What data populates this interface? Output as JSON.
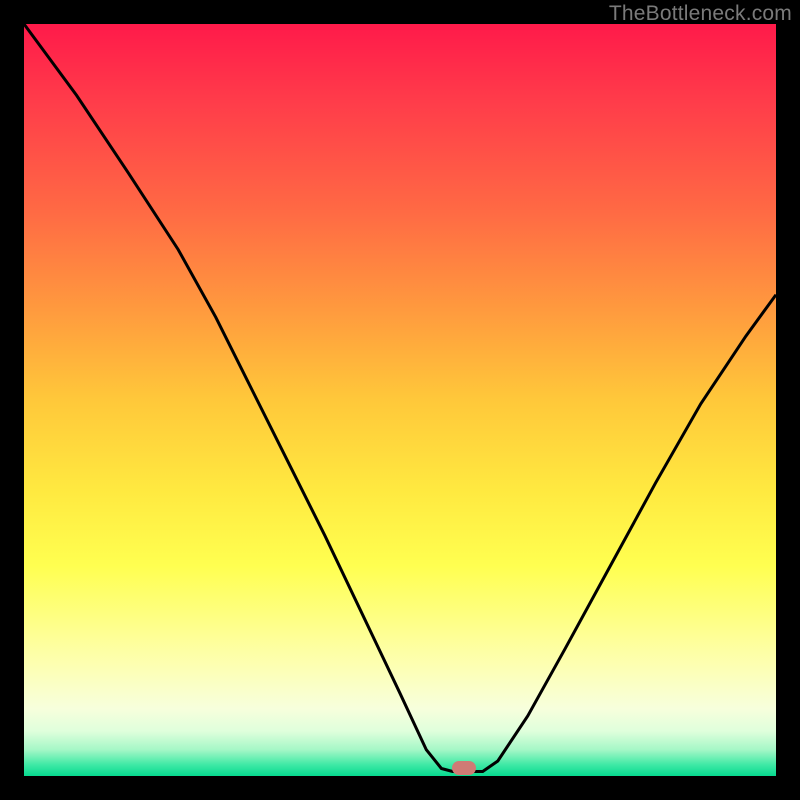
{
  "watermark": "TheBottleneck.com",
  "marker": {
    "x_frac": 0.585,
    "y_frac": 0.994
  },
  "chart_data": {
    "type": "line",
    "title": "",
    "xlabel": "",
    "ylabel": "",
    "xlim": [
      0,
      1
    ],
    "ylim": [
      0,
      1
    ],
    "series": [
      {
        "name": "bottleneck-curve",
        "points": [
          {
            "x": 0.0,
            "y": 1.0
          },
          {
            "x": 0.07,
            "y": 0.905
          },
          {
            "x": 0.14,
            "y": 0.8
          },
          {
            "x": 0.205,
            "y": 0.7
          },
          {
            "x": 0.255,
            "y": 0.61
          },
          {
            "x": 0.3,
            "y": 0.52
          },
          {
            "x": 0.35,
            "y": 0.42
          },
          {
            "x": 0.4,
            "y": 0.32
          },
          {
            "x": 0.45,
            "y": 0.215
          },
          {
            "x": 0.5,
            "y": 0.11
          },
          {
            "x": 0.535,
            "y": 0.035
          },
          {
            "x": 0.555,
            "y": 0.01
          },
          {
            "x": 0.57,
            "y": 0.006
          },
          {
            "x": 0.61,
            "y": 0.006
          },
          {
            "x": 0.63,
            "y": 0.02
          },
          {
            "x": 0.67,
            "y": 0.08
          },
          {
            "x": 0.72,
            "y": 0.17
          },
          {
            "x": 0.78,
            "y": 0.28
          },
          {
            "x": 0.84,
            "y": 0.39
          },
          {
            "x": 0.9,
            "y": 0.495
          },
          {
            "x": 0.96,
            "y": 0.585
          },
          {
            "x": 1.0,
            "y": 0.64
          }
        ]
      }
    ]
  },
  "colors": {
    "background": "#000000",
    "curve": "#000000",
    "marker": "#cf7b75",
    "watermark": "#7a7a7a"
  }
}
